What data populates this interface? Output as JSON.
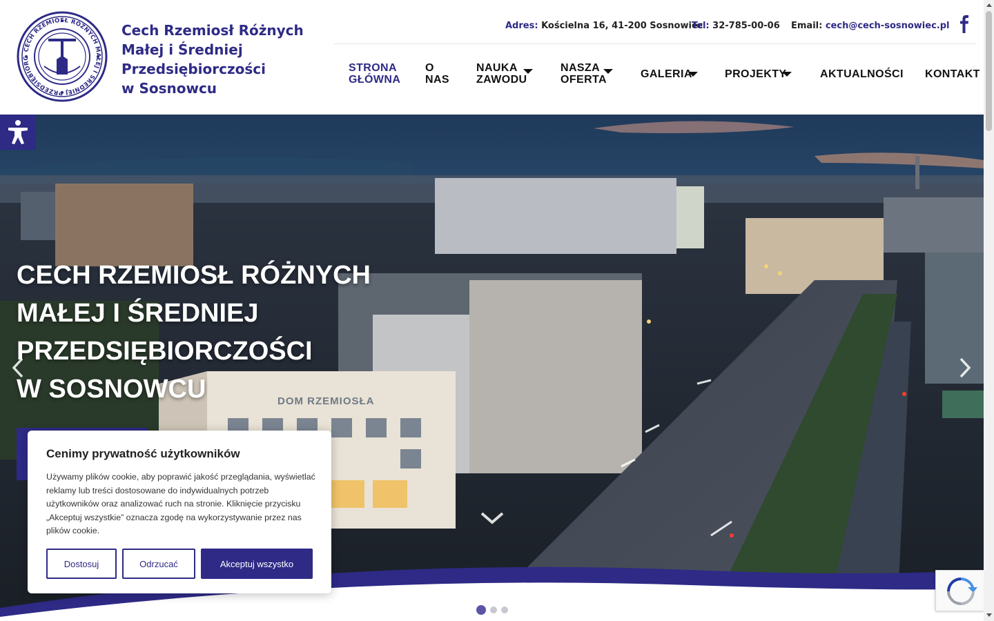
{
  "brand": {
    "name_lines": [
      "Cech Rzemiosł Różnych",
      "Małej i Średniej",
      "Przedsiębiorczości",
      "w Sosnowcu"
    ],
    "primary_color": "#2e2a86"
  },
  "contact": {
    "address_label": "Adres:",
    "address_value": "Kościelna 16, 41-200 Sosnowiec",
    "phone_label": "Tel:",
    "phone_value": "32-785-00-06",
    "email_label": "Email:",
    "email_value": "cech@cech-sosnowiec.pl",
    "facebook_icon": "facebook-icon"
  },
  "nav": {
    "items": [
      {
        "line1": "STRONA",
        "line2": "GŁÓWNA",
        "active": true,
        "dropdown": false
      },
      {
        "line1": "O",
        "line2": "NAS",
        "active": false,
        "dropdown": false
      },
      {
        "line1": "NAUKA",
        "line2": "ZAWODU",
        "active": false,
        "dropdown": true
      },
      {
        "line1": "NASZA",
        "line2": "OFERTA",
        "active": false,
        "dropdown": true
      },
      {
        "label": "GALERIA",
        "active": false,
        "dropdown": true
      },
      {
        "label": "PROJEKTY",
        "active": false,
        "dropdown": true
      },
      {
        "label": "AKTUALNOŚCI",
        "active": false,
        "dropdown": false
      },
      {
        "label": "KONTAKT",
        "active": false,
        "dropdown": false
      }
    ]
  },
  "hero": {
    "title_lines": [
      "CECH RZEMIOSŁ RÓŻNYCH",
      "MAŁEJ I ŚREDNIEJ",
      "PRZEDSIĘBIORCZOŚCI",
      "W SOSNOWCU"
    ],
    "building_sign": "DOM RZEMIOSŁA",
    "slides_total": 3,
    "slide_active": 1
  },
  "cookie": {
    "title": "Cenimy prywatność użytkowników",
    "text": "Używamy plików cookie, aby poprawić jakość przeglądania, wyświetlać reklamy lub treści dostosowane do indywidualnych potrzeb użytkowników oraz analizować ruch na stronie. Kliknięcie przycisku „Akceptuj wszystkie” oznacza zgodę na wykorzystywanie przez nas plików cookie.",
    "customize_label": "Dostosuj",
    "reject_label": "Odrzucać",
    "accept_label": "Akceptuj wszystko"
  },
  "icons": {
    "accessibility": "accessibility-icon",
    "prev": "chevron-left-icon",
    "next": "chevron-right-icon",
    "scroll": "chevron-down-icon",
    "captcha": "recaptcha-icon"
  }
}
